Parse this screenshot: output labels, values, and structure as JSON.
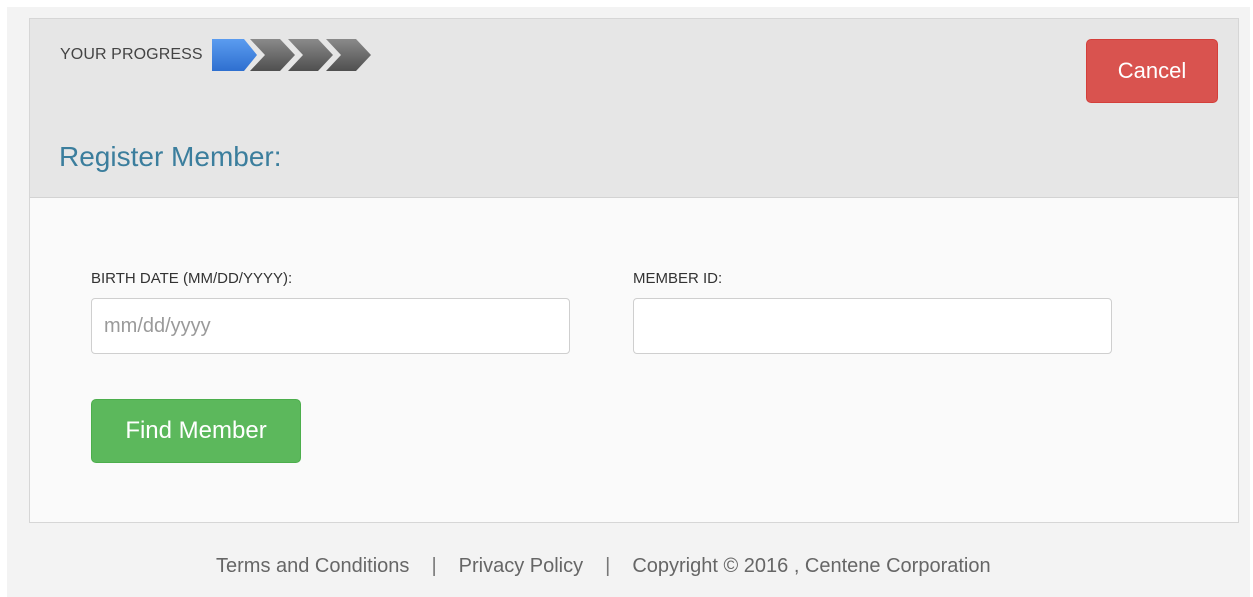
{
  "header": {
    "progress_label": "YOUR PROGRESS",
    "progress_steps_total": 4,
    "progress_steps_completed": 1,
    "cancel_label": "Cancel",
    "title": "Register Member:"
  },
  "form": {
    "birth_date_label": "BIRTH DATE (MM/DD/YYYY):",
    "birth_date_placeholder": "mm/dd/yyyy",
    "birth_date_value": "",
    "member_id_label": "MEMBER ID:",
    "member_id_value": "",
    "find_label": "Find Member"
  },
  "footer": {
    "terms": "Terms and Conditions",
    "separator": "|",
    "privacy": "Privacy Policy",
    "copyright": "Copyright © 2016 , Centene Corporation"
  },
  "colors": {
    "active_step": "#2e6fd0",
    "inactive_step": "#5a5a5a",
    "cancel": "#d9534f",
    "find": "#5cb85c",
    "title": "#3b7e9d"
  }
}
